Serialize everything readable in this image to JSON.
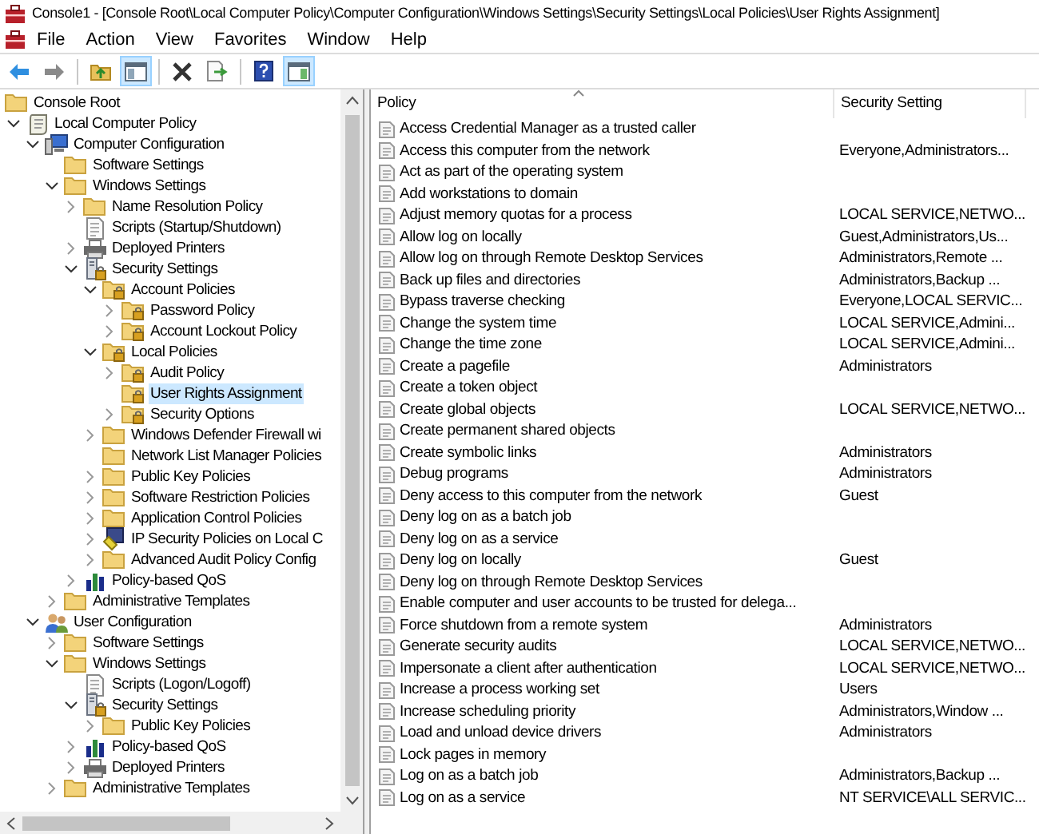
{
  "window": {
    "title": "Console1 - [Console Root\\Local Computer Policy\\Computer Configuration\\Windows Settings\\Security Settings\\Local Policies\\User Rights Assignment]"
  },
  "menu": [
    "File",
    "Action",
    "View",
    "Favorites",
    "Window",
    "Help"
  ],
  "toolbar": [
    {
      "kind": "back",
      "pressed": false
    },
    {
      "kind": "forward",
      "pressed": false
    },
    {
      "kind": "sep"
    },
    {
      "kind": "up",
      "pressed": false
    },
    {
      "kind": "tree",
      "pressed": true
    },
    {
      "kind": "sep"
    },
    {
      "kind": "delete",
      "pressed": false
    },
    {
      "kind": "export",
      "pressed": false
    },
    {
      "kind": "sep"
    },
    {
      "kind": "help",
      "pressed": false
    },
    {
      "kind": "pane",
      "pressed": true
    }
  ],
  "tree": [
    {
      "label": "Console Root",
      "kind": "folder",
      "selected": false
    },
    {
      "label": "Local Computer Policy",
      "kind": "policy",
      "expanded": true,
      "selected": false,
      "children": [
        {
          "label": "Computer Configuration",
          "kind": "computer",
          "expanded": true,
          "selected": false,
          "children": [
            {
              "label": "Software Settings",
              "kind": "folder",
              "selected": false
            },
            {
              "label": "Windows Settings",
              "kind": "folder",
              "expanded": true,
              "selected": false,
              "children": [
                {
                  "label": "Name Resolution Policy",
                  "kind": "folder",
                  "expanded": false,
                  "selected": false
                },
                {
                  "label": "Scripts (Startup/Shutdown)",
                  "kind": "script",
                  "selected": false
                },
                {
                  "label": "Deployed Printers",
                  "kind": "printer",
                  "expanded": false,
                  "selected": false
                },
                {
                  "label": "Security Settings",
                  "kind": "security",
                  "expanded": true,
                  "selected": false,
                  "children": [
                    {
                      "label": "Account Policies",
                      "kind": "lockfolder",
                      "expanded": true,
                      "selected": false,
                      "children": [
                        {
                          "label": "Password Policy",
                          "kind": "lockfolder",
                          "expanded": false,
                          "selected": false
                        },
                        {
                          "label": "Account Lockout Policy",
                          "kind": "lockfolder",
                          "expanded": false,
                          "selected": false
                        }
                      ]
                    },
                    {
                      "label": "Local Policies",
                      "kind": "lockfolder",
                      "expanded": true,
                      "selected": false,
                      "children": [
                        {
                          "label": "Audit Policy",
                          "kind": "lockfolder",
                          "expanded": false,
                          "selected": false
                        },
                        {
                          "label": "User Rights Assignment",
                          "kind": "lockfolder",
                          "selected": true
                        },
                        {
                          "label": "Security Options",
                          "kind": "lockfolder",
                          "expanded": false,
                          "selected": false
                        }
                      ]
                    },
                    {
                      "label": "Windows Defender Firewall wi",
                      "kind": "folder",
                      "expanded": false,
                      "selected": false
                    },
                    {
                      "label": "Network List Manager Policies",
                      "kind": "folder",
                      "selected": false
                    },
                    {
                      "label": "Public Key Policies",
                      "kind": "folder",
                      "expanded": false,
                      "selected": false
                    },
                    {
                      "label": "Software Restriction Policies",
                      "kind": "folder",
                      "expanded": false,
                      "selected": false
                    },
                    {
                      "label": "Application Control Policies",
                      "kind": "folder",
                      "expanded": false,
                      "selected": false
                    },
                    {
                      "label": "IP Security Policies on Local C",
                      "kind": "ipsec",
                      "expanded": false,
                      "selected": false
                    },
                    {
                      "label": "Advanced Audit Policy Config",
                      "kind": "folder",
                      "expanded": false,
                      "selected": false
                    }
                  ]
                },
                {
                  "label": "Policy-based QoS",
                  "kind": "qos",
                  "expanded": false,
                  "selected": false
                }
              ]
            },
            {
              "label": "Administrative Templates",
              "kind": "folder",
              "expanded": false,
              "selected": false
            }
          ]
        },
        {
          "label": "User Configuration",
          "kind": "user",
          "expanded": true,
          "selected": false,
          "children": [
            {
              "label": "Software Settings",
              "kind": "folder",
              "expanded": false,
              "selected": false
            },
            {
              "label": "Windows Settings",
              "kind": "folder",
              "expanded": true,
              "selected": false,
              "children": [
                {
                  "label": "Scripts (Logon/Logoff)",
                  "kind": "script",
                  "selected": false
                },
                {
                  "label": "Security Settings",
                  "kind": "security",
                  "expanded": true,
                  "selected": false,
                  "children": [
                    {
                      "label": "Public Key Policies",
                      "kind": "folder",
                      "expanded": false,
                      "selected": false
                    }
                  ]
                },
                {
                  "label": "Policy-based QoS",
                  "kind": "qos",
                  "expanded": false,
                  "selected": false
                },
                {
                  "label": "Deployed Printers",
                  "kind": "printer",
                  "expanded": false,
                  "selected": false
                }
              ]
            },
            {
              "label": "Administrative Templates",
              "kind": "folder",
              "expanded": false,
              "selected": false
            }
          ]
        }
      ]
    }
  ],
  "table": {
    "columns": [
      "Policy",
      "Security Setting"
    ],
    "rows": [
      [
        "Access Credential Manager as a trusted caller",
        ""
      ],
      [
        "Access this computer from the network",
        "Everyone,Administrators..."
      ],
      [
        "Act as part of the operating system",
        ""
      ],
      [
        "Add workstations to domain",
        ""
      ],
      [
        "Adjust memory quotas for a process",
        "LOCAL SERVICE,NETWO..."
      ],
      [
        "Allow log on locally",
        "Guest,Administrators,Us..."
      ],
      [
        "Allow log on through Remote Desktop Services",
        "Administrators,Remote ..."
      ],
      [
        "Back up files and directories",
        "Administrators,Backup ..."
      ],
      [
        "Bypass traverse checking",
        "Everyone,LOCAL SERVIC..."
      ],
      [
        "Change the system time",
        "LOCAL SERVICE,Admini..."
      ],
      [
        "Change the time zone",
        "LOCAL SERVICE,Admini..."
      ],
      [
        "Create a pagefile",
        "Administrators"
      ],
      [
        "Create a token object",
        ""
      ],
      [
        "Create global objects",
        "LOCAL SERVICE,NETWO..."
      ],
      [
        "Create permanent shared objects",
        ""
      ],
      [
        "Create symbolic links",
        "Administrators"
      ],
      [
        "Debug programs",
        "Administrators"
      ],
      [
        "Deny access to this computer from the network",
        "Guest"
      ],
      [
        "Deny log on as a batch job",
        ""
      ],
      [
        "Deny log on as a service",
        ""
      ],
      [
        "Deny log on locally",
        "Guest"
      ],
      [
        "Deny log on through Remote Desktop Services",
        ""
      ],
      [
        "Enable computer and user accounts to be trusted for delega...",
        ""
      ],
      [
        "Force shutdown from a remote system",
        "Administrators"
      ],
      [
        "Generate security audits",
        "LOCAL SERVICE,NETWO..."
      ],
      [
        "Impersonate a client after authentication",
        "LOCAL SERVICE,NETWO..."
      ],
      [
        "Increase a process working set",
        "Users"
      ],
      [
        "Increase scheduling priority",
        "Administrators,Window ..."
      ],
      [
        "Load and unload device drivers",
        "Administrators"
      ],
      [
        "Lock pages in memory",
        ""
      ],
      [
        "Log on as a batch job",
        "Administrators,Backup ..."
      ],
      [
        "Log on as a service",
        "NT SERVICE\\ALL SERVIC..."
      ]
    ]
  }
}
